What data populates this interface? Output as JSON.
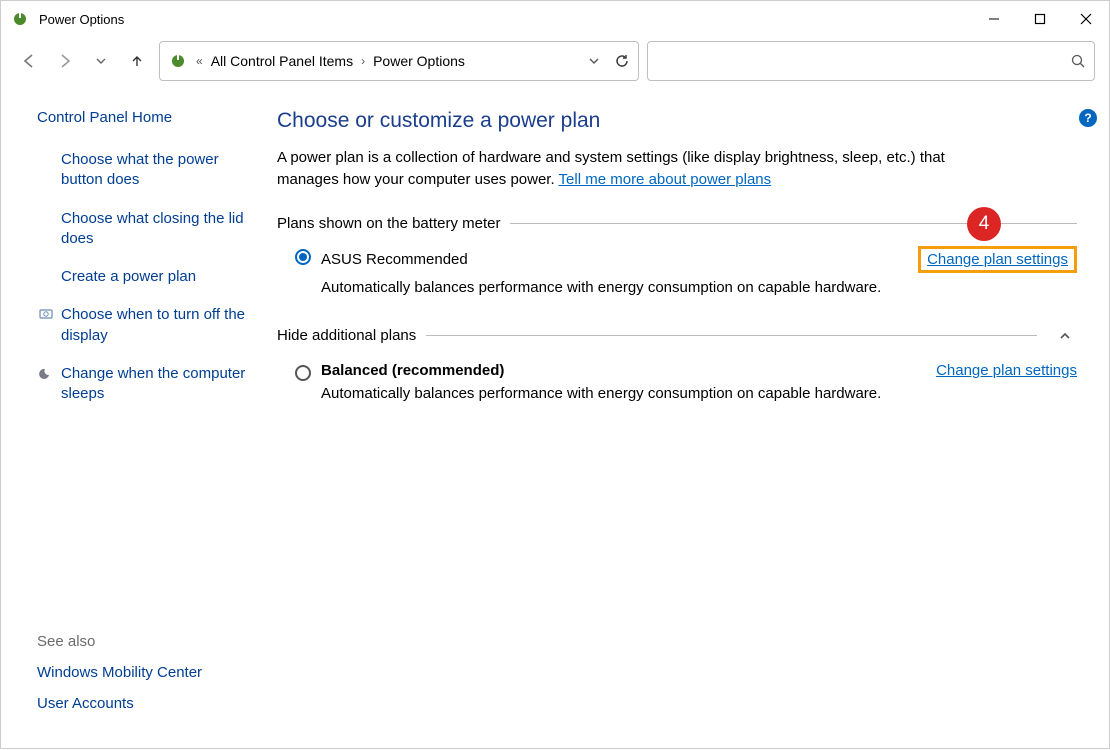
{
  "window": {
    "title": "Power Options"
  },
  "breadcrumb": {
    "parent": "All Control Panel Items",
    "current": "Power Options"
  },
  "help_icon_label": "?",
  "sidebar": {
    "home": "Control Panel Home",
    "links": [
      {
        "label": "Choose what the power button does",
        "icon": null
      },
      {
        "label": "Choose what closing the lid does",
        "icon": null
      },
      {
        "label": "Create a power plan",
        "icon": null
      },
      {
        "label": "Choose when to turn off the display",
        "icon": "display-clock"
      },
      {
        "label": "Change when the computer sleeps",
        "icon": "moon"
      }
    ],
    "seealso_heading": "See also",
    "seealso": [
      "Windows Mobility Center",
      "User Accounts"
    ]
  },
  "main": {
    "title": "Choose or customize a power plan",
    "description_a": "A power plan is a collection of hardware and system settings (like display brightness, sleep, etc.) that manages how your computer uses power. ",
    "description_link": "Tell me more about power plans",
    "section1_label": "Plans shown on the battery meter",
    "section2_label": "Hide additional plans",
    "change_label": "Change plan settings",
    "plans_shown": [
      {
        "name": "ASUS Recommended",
        "selected": true,
        "desc": "Automatically balances performance with energy consumption on capable hardware."
      }
    ],
    "plans_hidden": [
      {
        "name": "Balanced (recommended)",
        "selected": false,
        "bold": true,
        "desc": "Automatically balances performance with energy consumption on capable hardware."
      }
    ]
  },
  "annotation": {
    "number": "4"
  }
}
